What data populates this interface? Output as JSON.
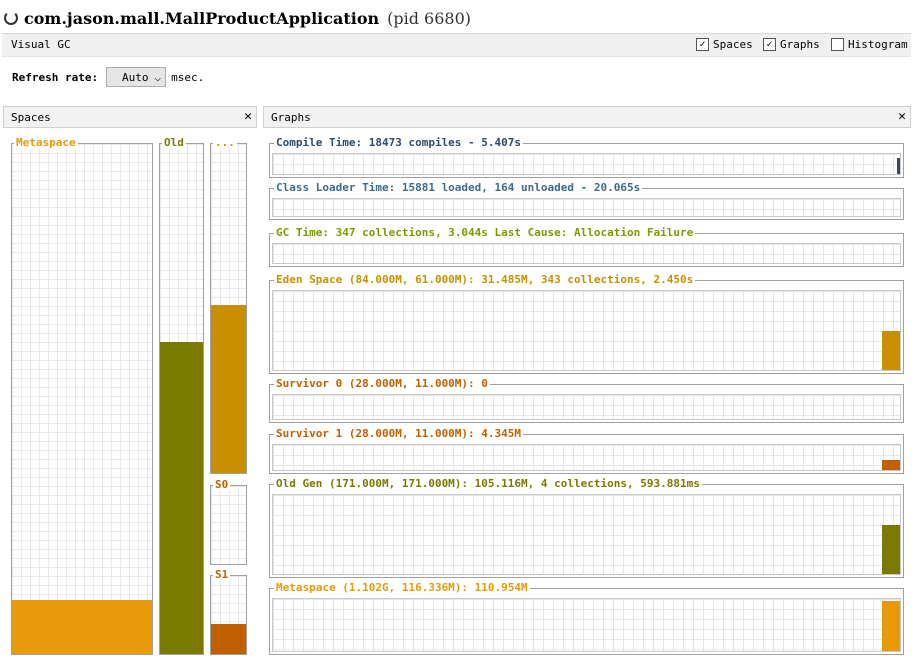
{
  "window": {
    "title": "com.jason.mall.MallProductApplication",
    "pid": "(pid 6680)"
  },
  "tab": {
    "label": "Visual GC",
    "checkboxes": [
      {
        "label": "Spaces",
        "checked": true
      },
      {
        "label": "Graphs",
        "checked": true
      },
      {
        "label": "Histogram",
        "checked": false
      }
    ]
  },
  "refresh": {
    "label": "Refresh rate:",
    "value": "Auto",
    "unit": "msec."
  },
  "spaces_panel": {
    "title": "Spaces",
    "pools": {
      "metaspace": {
        "label": "Metaspace",
        "color": "#e89a0a",
        "fill": 0.105
      },
      "old": {
        "label": "Old",
        "color": "#7a7a00",
        "fill": 0.612
      },
      "eden": {
        "label": "...",
        "color": "#c98f00",
        "fill": 0.51
      },
      "s0": {
        "label": "S0",
        "color": "#c06000",
        "fill": 0.0
      },
      "s1": {
        "label": "S1",
        "color": "#c06000",
        "fill": 0.385
      }
    }
  },
  "graphs_panel": {
    "title": "Graphs",
    "graphs": [
      {
        "label": "Compile Time: 18473 compiles - 5.407s",
        "color": "#2e4b69",
        "fill": 0.8
      },
      {
        "label": "Class Loader Time: 15881 loaded, 164 unloaded - 20.065s",
        "color": "#3c6b8c",
        "fill": 0.0
      },
      {
        "label": "GC Time: 347 collections, 3.044s  Last Cause: Allocation Failure",
        "color": "#7a9a00",
        "fill": 0.0
      },
      {
        "label": "Eden Space (84.000M, 61.000M): 31.485M, 343 collections, 2.450s",
        "color": "#c98f00",
        "fill": 0.49
      },
      {
        "label": "Survivor 0 (28.000M, 11.000M): 0",
        "color": "#c06000",
        "fill": 0.0
      },
      {
        "label": "Survivor 1 (28.000M, 11.000M): 4.345M",
        "color": "#c06000",
        "fill": 0.395
      },
      {
        "label": "Old Gen (171.000M, 171.000M): 105.116M, 4 collections, 593.881ms",
        "color": "#7a7a00",
        "fill": 0.615
      },
      {
        "label": "Metaspace (1.102G, 116.336M): 110.954M",
        "color": "#e89a0a",
        "fill": 0.954
      }
    ]
  }
}
